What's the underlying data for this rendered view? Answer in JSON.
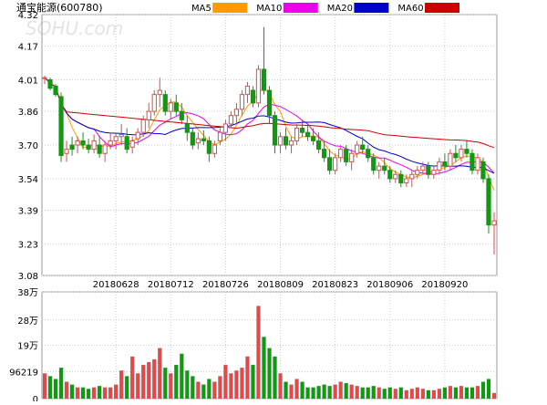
{
  "chart_data": {
    "type": "candlestick",
    "title": "通宝能源(600780)",
    "watermark": "SOHU.com",
    "colors": {
      "up": "#e04a4a",
      "down": "#119911"
    },
    "legend": [
      {
        "name": "MA5",
        "color": "#ff9a00"
      },
      {
        "name": "MA10",
        "color": "#ee00ee"
      },
      {
        "name": "MA20",
        "color": "#0000cc"
      },
      {
        "name": "MA60",
        "color": "#cc0000"
      }
    ],
    "price_axis": {
      "min": 3.08,
      "max": 4.32,
      "ticks": [
        4.32,
        4.17,
        4.01,
        3.86,
        3.7,
        3.54,
        3.39,
        3.23,
        3.08
      ]
    },
    "volume_axis": {
      "max": 380000,
      "ticks": [
        {
          "label": "38万",
          "value": 380000
        },
        {
          "label": "28万",
          "value": 280000
        },
        {
          "label": "19万",
          "value": 190000
        },
        {
          "label": "96219",
          "value": 96219
        },
        {
          "label": "0",
          "value": 0
        }
      ]
    },
    "x_labels": [
      {
        "label": "20180628",
        "index": 13
      },
      {
        "label": "20180712",
        "index": 23
      },
      {
        "label": "20180726",
        "index": 33
      },
      {
        "label": "20180809",
        "index": 43
      },
      {
        "label": "20180823",
        "index": 53
      },
      {
        "label": "20180906",
        "index": 63
      },
      {
        "label": "20180920",
        "index": 73
      }
    ],
    "candles": [
      [
        4.02,
        4.03,
        3.99,
        4.02,
        90000
      ],
      [
        4.01,
        4.02,
        3.96,
        3.97,
        80000
      ],
      [
        3.98,
        3.99,
        3.93,
        3.94,
        70000
      ],
      [
        3.93,
        3.95,
        3.62,
        3.65,
        110000
      ],
      [
        3.66,
        3.72,
        3.62,
        3.68,
        60000
      ],
      [
        3.7,
        3.74,
        3.65,
        3.68,
        50000
      ],
      [
        3.7,
        3.74,
        3.66,
        3.72,
        40000
      ],
      [
        3.72,
        3.76,
        3.68,
        3.7,
        40000
      ],
      [
        3.7,
        3.73,
        3.66,
        3.68,
        35000
      ],
      [
        3.68,
        3.75,
        3.66,
        3.72,
        40000
      ],
      [
        3.7,
        3.74,
        3.64,
        3.66,
        45000
      ],
      [
        3.66,
        3.72,
        3.62,
        3.7,
        40000
      ],
      [
        3.7,
        3.76,
        3.68,
        3.72,
        40000
      ],
      [
        3.72,
        3.76,
        3.68,
        3.74,
        50000
      ],
      [
        3.74,
        3.8,
        3.7,
        3.75,
        100000
      ],
      [
        3.74,
        3.78,
        3.66,
        3.68,
        80000
      ],
      [
        3.69,
        3.74,
        3.66,
        3.72,
        150000
      ],
      [
        3.73,
        3.78,
        3.7,
        3.76,
        90000
      ],
      [
        3.76,
        3.84,
        3.74,
        3.82,
        120000
      ],
      [
        3.82,
        3.9,
        3.78,
        3.86,
        130000
      ],
      [
        3.86,
        3.96,
        3.84,
        3.94,
        140000
      ],
      [
        3.94,
        4.02,
        3.88,
        3.96,
        180000
      ],
      [
        3.94,
        3.96,
        3.84,
        3.86,
        110000
      ],
      [
        3.86,
        3.92,
        3.82,
        3.9,
        90000
      ],
      [
        3.9,
        3.94,
        3.84,
        3.86,
        120000
      ],
      [
        3.86,
        3.9,
        3.8,
        3.82,
        160000
      ],
      [
        3.8,
        3.84,
        3.72,
        3.76,
        100000
      ],
      [
        3.76,
        3.78,
        3.68,
        3.7,
        80000
      ],
      [
        3.71,
        3.76,
        3.68,
        3.73,
        60000
      ],
      [
        3.73,
        3.77,
        3.7,
        3.72,
        50000
      ],
      [
        3.72,
        3.74,
        3.62,
        3.66,
        70000
      ],
      [
        3.66,
        3.72,
        3.64,
        3.7,
        60000
      ],
      [
        3.72,
        3.78,
        3.7,
        3.76,
        80000
      ],
      [
        3.76,
        3.82,
        3.72,
        3.8,
        120000
      ],
      [
        3.8,
        3.86,
        3.78,
        3.84,
        90000
      ],
      [
        3.84,
        3.9,
        3.8,
        3.87,
        100000
      ],
      [
        3.87,
        3.96,
        3.84,
        3.94,
        110000
      ],
      [
        3.94,
        4.0,
        3.9,
        3.98,
        150000
      ],
      [
        3.96,
        3.98,
        3.88,
        3.9,
        120000
      ],
      [
        3.9,
        4.08,
        3.88,
        4.06,
        330000
      ],
      [
        4.06,
        4.26,
        3.94,
        3.96,
        220000
      ],
      [
        3.96,
        3.98,
        3.8,
        3.84,
        180000
      ],
      [
        3.84,
        3.86,
        3.66,
        3.7,
        150000
      ],
      [
        3.7,
        3.76,
        3.66,
        3.74,
        90000
      ],
      [
        3.74,
        3.78,
        3.68,
        3.7,
        60000
      ],
      [
        3.7,
        3.74,
        3.66,
        3.72,
        50000
      ],
      [
        3.72,
        3.8,
        3.7,
        3.78,
        70000
      ],
      [
        3.78,
        3.82,
        3.74,
        3.76,
        60000
      ],
      [
        3.76,
        3.8,
        3.72,
        3.74,
        40000
      ],
      [
        3.74,
        3.78,
        3.7,
        3.72,
        40000
      ],
      [
        3.72,
        3.76,
        3.66,
        3.68,
        45000
      ],
      [
        3.68,
        3.72,
        3.62,
        3.64,
        50000
      ],
      [
        3.64,
        3.68,
        3.56,
        3.58,
        45000
      ],
      [
        3.58,
        3.66,
        3.56,
        3.64,
        50000
      ],
      [
        3.64,
        3.7,
        3.62,
        3.68,
        60000
      ],
      [
        3.68,
        3.7,
        3.6,
        3.62,
        55000
      ],
      [
        3.62,
        3.68,
        3.58,
        3.66,
        50000
      ],
      [
        3.66,
        3.72,
        3.64,
        3.7,
        45000
      ],
      [
        3.7,
        3.74,
        3.66,
        3.68,
        40000
      ],
      [
        3.68,
        3.7,
        3.62,
        3.64,
        40000
      ],
      [
        3.64,
        3.66,
        3.56,
        3.58,
        45000
      ],
      [
        3.58,
        3.62,
        3.54,
        3.6,
        40000
      ],
      [
        3.6,
        3.64,
        3.56,
        3.58,
        35000
      ],
      [
        3.58,
        3.6,
        3.52,
        3.54,
        40000
      ],
      [
        3.54,
        3.58,
        3.52,
        3.56,
        35000
      ],
      [
        3.56,
        3.58,
        3.5,
        3.52,
        40000
      ],
      [
        3.52,
        3.56,
        3.5,
        3.54,
        30000
      ],
      [
        3.54,
        3.58,
        3.5,
        3.56,
        35000
      ],
      [
        3.56,
        3.6,
        3.54,
        3.58,
        40000
      ],
      [
        3.58,
        3.62,
        3.56,
        3.6,
        35000
      ],
      [
        3.6,
        3.62,
        3.54,
        3.56,
        30000
      ],
      [
        3.56,
        3.6,
        3.54,
        3.58,
        30000
      ],
      [
        3.58,
        3.64,
        3.56,
        3.62,
        35000
      ],
      [
        3.62,
        3.66,
        3.58,
        3.6,
        40000
      ],
      [
        3.6,
        3.68,
        3.58,
        3.66,
        45000
      ],
      [
        3.66,
        3.7,
        3.62,
        3.64,
        40000
      ],
      [
        3.64,
        3.7,
        3.62,
        3.68,
        45000
      ],
      [
        3.68,
        3.72,
        3.64,
        3.66,
        40000
      ],
      [
        3.66,
        3.68,
        3.56,
        3.58,
        40000
      ],
      [
        3.58,
        3.66,
        3.56,
        3.64,
        45000
      ],
      [
        3.62,
        3.64,
        3.52,
        3.54,
        60000
      ],
      [
        3.54,
        3.56,
        3.28,
        3.32,
        70000
      ],
      [
        3.32,
        3.38,
        3.18,
        3.34,
        20000
      ]
    ]
  }
}
